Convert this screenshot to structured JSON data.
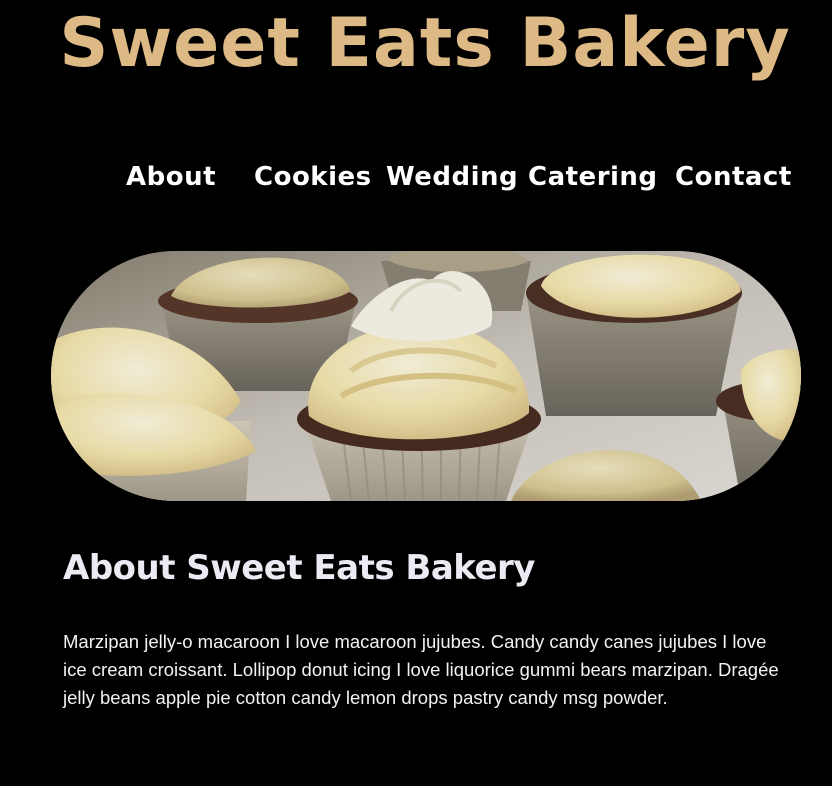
{
  "site": {
    "title": "Sweet Eats Bakery",
    "accent_color": "#ddb985",
    "background_color": "#000000"
  },
  "nav": {
    "items": [
      {
        "label": "About"
      },
      {
        "label": "Cookies"
      },
      {
        "label": "Wedding"
      },
      {
        "label": "Catering"
      },
      {
        "label": "Contact"
      }
    ]
  },
  "hero": {
    "image_subject": "cupcakes-with-cream-frosting-photo"
  },
  "about": {
    "heading": "About Sweet Eats Bakery",
    "body": "Marzipan jelly-o macaroon I love macaroon jujubes. Candy candy canes jujubes I love ice cream croissant. Lollipop donut icing I love liquorice gummi bears marzipan. Dragée jelly beans apple pie cotton candy lemon drops pastry candy msg powder."
  }
}
